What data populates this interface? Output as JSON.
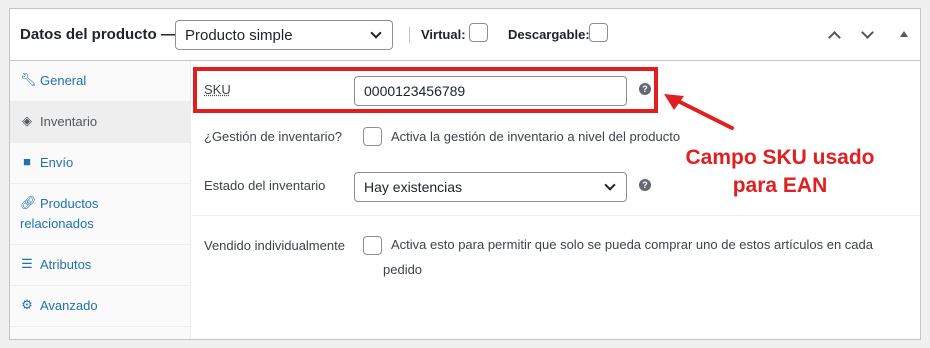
{
  "header": {
    "title": "Datos del producto —",
    "product_type": "Producto simple",
    "virtual_label": "Virtual:",
    "downloadable_label": "Descargable:"
  },
  "sidebar": {
    "items": [
      {
        "label": "General",
        "icon": "wrench-icon",
        "active": false
      },
      {
        "label": "Inventario",
        "icon": "tag-icon",
        "active": true
      },
      {
        "label": "Envío",
        "icon": "truck-icon",
        "active": false
      },
      {
        "label": "Productos relacionados",
        "icon": "link-icon",
        "active": false
      },
      {
        "label": "Atributos",
        "icon": "list-icon",
        "active": false
      },
      {
        "label": "Avanzado",
        "icon": "gear-icon",
        "active": false
      }
    ]
  },
  "inventory": {
    "sku_label": "SKU",
    "sku_value": "0000123456789",
    "manage_stock_label": "¿Gestión de inventario?",
    "manage_stock_desc": "Activa la gestión de inventario a nivel del producto",
    "stock_status_label": "Estado del inventario",
    "stock_status_value": "Hay existencias",
    "sold_individually_label": "Vendido individualmente",
    "sold_individually_desc": "Activa esto para permitir que solo se pueda comprar uno de estos artículos en cada pedido"
  },
  "annotation": {
    "line1": "Campo SKU usado",
    "line2": "para EAN",
    "color": "#e02020"
  },
  "help_glyph": "?"
}
